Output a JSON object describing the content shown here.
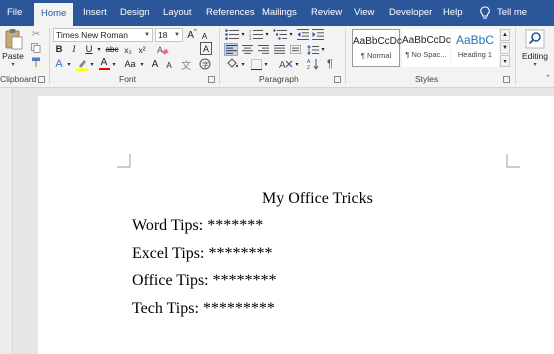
{
  "tabs": {
    "file": "File",
    "home": "Home",
    "insert": "Insert",
    "design": "Design",
    "layout": "Layout",
    "references": "References",
    "mailings": "Mailings",
    "review": "Review",
    "view": "View",
    "developer": "Developer",
    "help": "Help",
    "tellme": "Tell me"
  },
  "ribbon": {
    "clipboard": {
      "label": "Clipboard",
      "paste_label": "Paste"
    },
    "font": {
      "label": "Font",
      "font_name": "Times New Roman",
      "font_size": "18",
      "bold": "B",
      "italic": "I",
      "underline": "U",
      "strikethrough": "abc",
      "subscript": "x₂",
      "superscript": "x²",
      "text_effects": "A",
      "font_color": "A",
      "change_case": "Aa",
      "grow": "A",
      "shrink": "A",
      "char_border": "A",
      "font_color_hex": "#ff0000",
      "highlight_color_hex": "#ffff00"
    },
    "paragraph": {
      "label": "Paragraph"
    },
    "styles": {
      "label": "Styles",
      "items": [
        {
          "sample": "AaBbCcDc",
          "name": "¶ Normal"
        },
        {
          "sample": "AaBbCcDc",
          "name": "¶ No Spac..."
        },
        {
          "sample": "AaBbC",
          "name": "Heading 1"
        }
      ]
    },
    "editing": {
      "label": "Editing"
    }
  },
  "document": {
    "title": "My Office Tricks",
    "lines": [
      "Word Tips: *******",
      "Excel Tips:  ********",
      "Office Tips: ********",
      "Tech Tips:  *********"
    ]
  },
  "colors": {
    "accent": "#2b579a",
    "ribbon_bg": "#f3f3f3",
    "page_bg": "#ffffff"
  }
}
